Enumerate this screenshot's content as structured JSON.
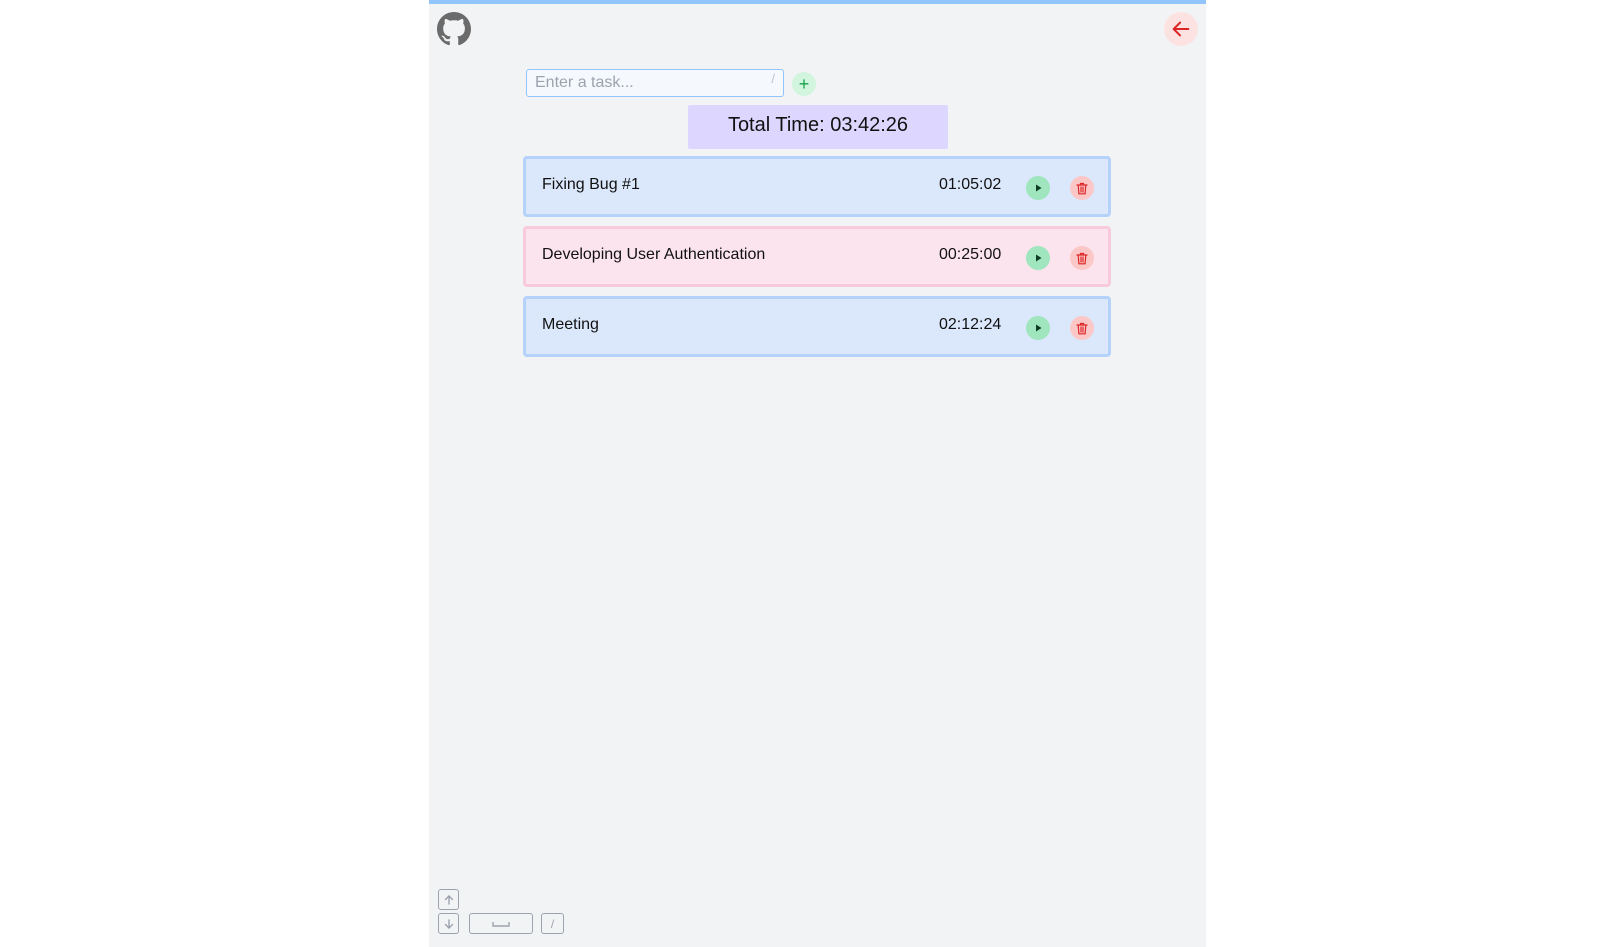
{
  "header": {
    "github_icon": "github-icon",
    "back_icon": "arrow-left-icon"
  },
  "task_input": {
    "placeholder": "Enter a task...",
    "shortcut_hint": "/",
    "add_label": "+"
  },
  "total": {
    "label": "Total Time: 03:42:26"
  },
  "tasks": [
    {
      "name": "Fixing Bug #1",
      "time": "01:05:02",
      "color": "#dbe8fc"
    },
    {
      "name": "Developing User Authentication",
      "time": "00:25:00",
      "color": "#fce4ef"
    },
    {
      "name": "Meeting",
      "time": "02:12:24",
      "color": "#dbe8fc"
    }
  ],
  "shortcuts": {
    "up_icon": "arrow-up-key-icon",
    "down_icon": "arrow-down-key-icon",
    "space_icon": "space-key-icon",
    "slash_label": "/"
  },
  "colors": {
    "accent": "#93c5fd",
    "total_bg": "#ddd6fe",
    "play": "#9fe5bd",
    "delete": "#fbc7c7"
  }
}
